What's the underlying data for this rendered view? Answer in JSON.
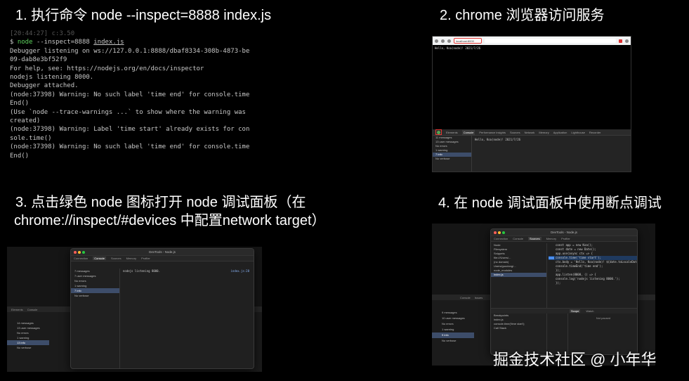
{
  "headings": {
    "h1": "1. 执行命令  node --inspect=8888 index.js",
    "h2": "2. chrome 浏览器访问服务",
    "h3_line1": "3. 点击绿色 node 图标打开 node 调试面板（在",
    "h3_line2": "chrome://inspect/#devices 中配置network target）",
    "h4": "4. 在 node 调试面板中使用断点调试"
  },
  "terminal": {
    "faded_line": "[20:44:27] c:3.50",
    "prompt": "$",
    "command_node": "node",
    "command_args": " --inspect=8888 ",
    "command_file": "index.js",
    "lines": [
      "Debugger listening on ws://127.0.0.1:8888/dbaf8334-308b-4873-be",
      "09-dab8e3bf52f9",
      "For help, see: https://nodejs.org/en/docs/inspector",
      "nodejs listening 8000.",
      "Debugger attached.",
      "(node:37398) Warning: No such label 'time end' for console.time",
      "End()",
      "(Use `node --trace-warnings ...` to show where the warning was",
      "created)",
      "(node:37398) Warning: Label 'time start' already exists for con",
      "sole.time()",
      "(node:37398) Warning: No such label 'time end' for console.time",
      "End()"
    ]
  },
  "chrome": {
    "url": "localhost:8000",
    "page_text": "Hello, Koa(node)! 2021/7/26",
    "tabs": [
      "Elements",
      "Console",
      "Performance insights",
      "Sources",
      "Network",
      "Memory",
      "Application",
      "Lighthouse",
      "Recorder"
    ],
    "active_tab": "Console",
    "sidebar": [
      "11 messages",
      "13 user messages",
      "No errors",
      "1 warning",
      "7 info",
      "No verbose"
    ],
    "console_line": "Hello, Koa(node)! 2021/7/26"
  },
  "p3": {
    "under_tabs": [
      "Elements",
      "Console"
    ],
    "under_items": [
      "14 messages",
      "13 user messages",
      "No errors",
      "1 warning",
      "13 info",
      "No verbose"
    ],
    "window_title": "DevTools - Node.js",
    "tabs": [
      "Connection",
      "Console",
      "Sources",
      "Memory",
      "Profiler"
    ],
    "active_tab": "Console",
    "side": [
      "7 messages",
      "7 user messages",
      "No errors",
      "1 warning",
      "7 info",
      "No verbose"
    ],
    "main_text": "nodejs listening 8000.",
    "main_link": "index.js:28"
  },
  "p4": {
    "window_title": "DevTools - Node.js",
    "tabs": [
      "Connection",
      "Console",
      "Sources",
      "Memory",
      "Profiler"
    ],
    "active_tab": "Sources",
    "files": [
      "Node",
      "Filesystem",
      "Snippets",
      "file:///Users/...",
      "(no domain)",
      "Users/guodong/...",
      "node_modules",
      "index.js"
    ],
    "code": [
      "const app = new Koa();",
      "const date = new Date();",
      "app.use(async ctx => {",
      "  console.time('time start');",
      "  ctx.body = 'Hello, Koa(node)! ${date.toLocaleDateString()}';",
      "  console.timeEnd('time end');",
      "});",
      "app.listen(8000, () => {",
      "  console.log('nodejs listening 8000.');",
      "});"
    ],
    "bg_tabs": [
      "Console",
      "Issues"
    ],
    "bg_items": [
      "9 messages",
      "10 user messages",
      "No errors",
      "1 warning",
      "9 info",
      "No verbose"
    ],
    "breakpoints_title": "Breakpoints",
    "breakpoint_file": "index.js",
    "breakpoint_code": "console.time('time start');",
    "callstack_title": "Call Stack",
    "scope_tabs": [
      "Scope",
      "Watch"
    ],
    "scope_msg": "Not paused"
  },
  "watermark": "掘金技术社区 @ 小年华"
}
